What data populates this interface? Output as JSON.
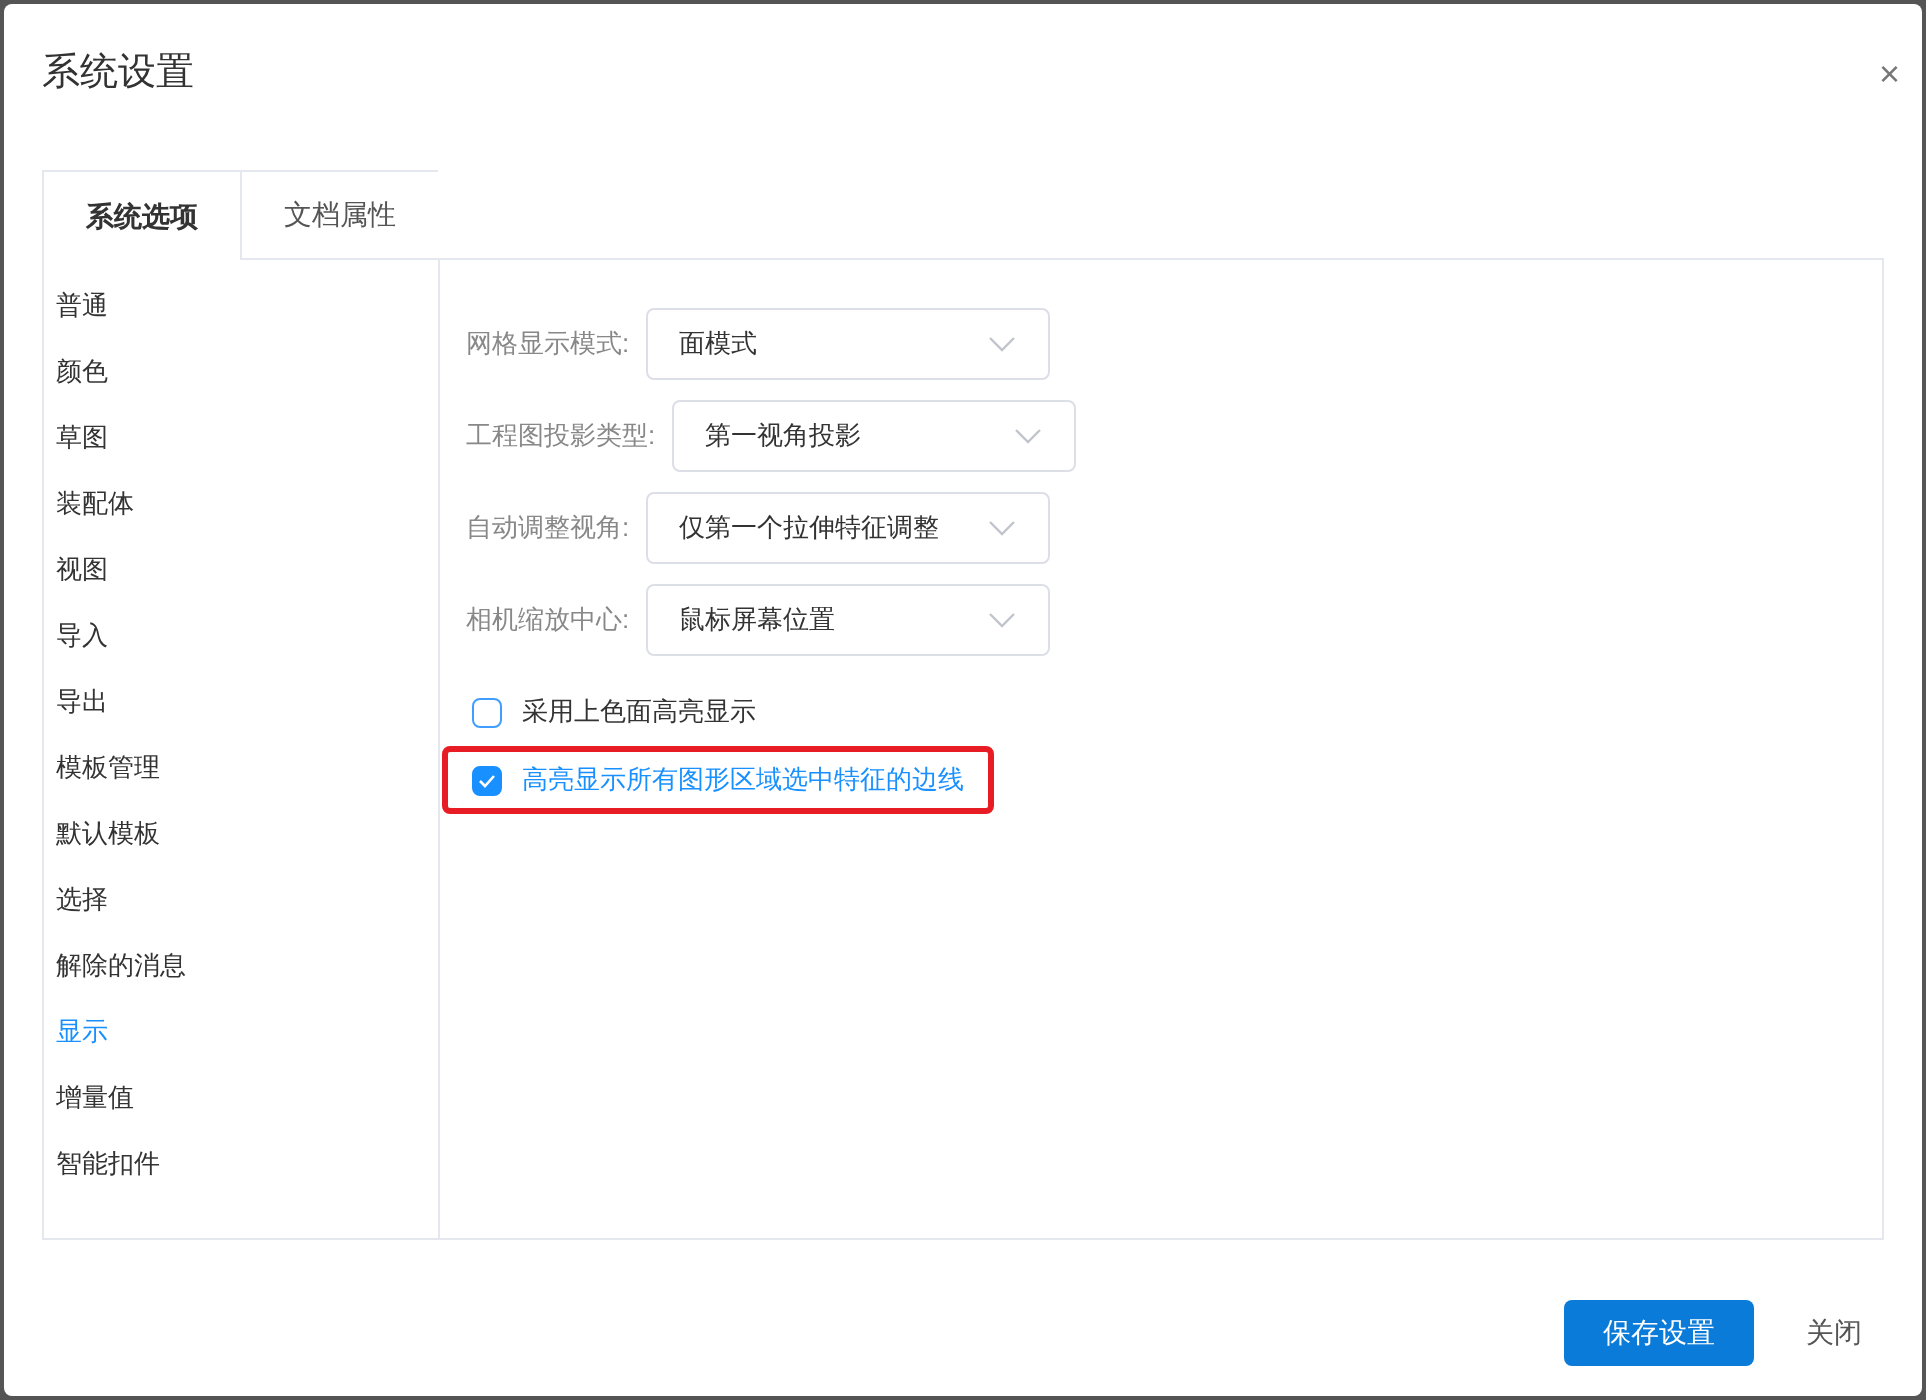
{
  "window": {
    "title": "系统设置",
    "close": "×"
  },
  "tabs": [
    {
      "label": "系统选项",
      "selected": true
    },
    {
      "label": "文档属性",
      "selected": false
    }
  ],
  "sidebar": {
    "items": [
      {
        "label": "普通",
        "selected": false
      },
      {
        "label": "颜色",
        "selected": false
      },
      {
        "label": "草图",
        "selected": false
      },
      {
        "label": "装配体",
        "selected": false
      },
      {
        "label": "视图",
        "selected": false
      },
      {
        "label": "导入",
        "selected": false
      },
      {
        "label": "导出",
        "selected": false
      },
      {
        "label": "模板管理",
        "selected": false
      },
      {
        "label": "默认模板",
        "selected": false
      },
      {
        "label": "选择",
        "selected": false
      },
      {
        "label": "解除的消息",
        "selected": false
      },
      {
        "label": "显示",
        "selected": true
      },
      {
        "label": "增量值",
        "selected": false
      },
      {
        "label": "智能扣件",
        "selected": false
      }
    ]
  },
  "settings": [
    {
      "kind": "select",
      "label": "网格显示模式:",
      "value": "面模式"
    },
    {
      "kind": "select",
      "label": "工程图投影类型:",
      "value": "第一视角投影"
    },
    {
      "kind": "select",
      "label": "自动调整视角:",
      "value": "仅第一个拉伸特征调整"
    },
    {
      "kind": "select",
      "label": "相机缩放中心:",
      "value": "鼠标屏幕位置"
    },
    {
      "kind": "checkbox",
      "label": "采用上色面高亮显示",
      "checked": false,
      "highlighted": false
    },
    {
      "kind": "checkbox",
      "label": "高亮显示所有图形区域选中特征的边线",
      "checked": true,
      "highlighted": true
    }
  ],
  "buttons": [
    {
      "kind": "primary",
      "label": "保存设置"
    },
    {
      "kind": "text",
      "label": "关闭"
    }
  ]
}
